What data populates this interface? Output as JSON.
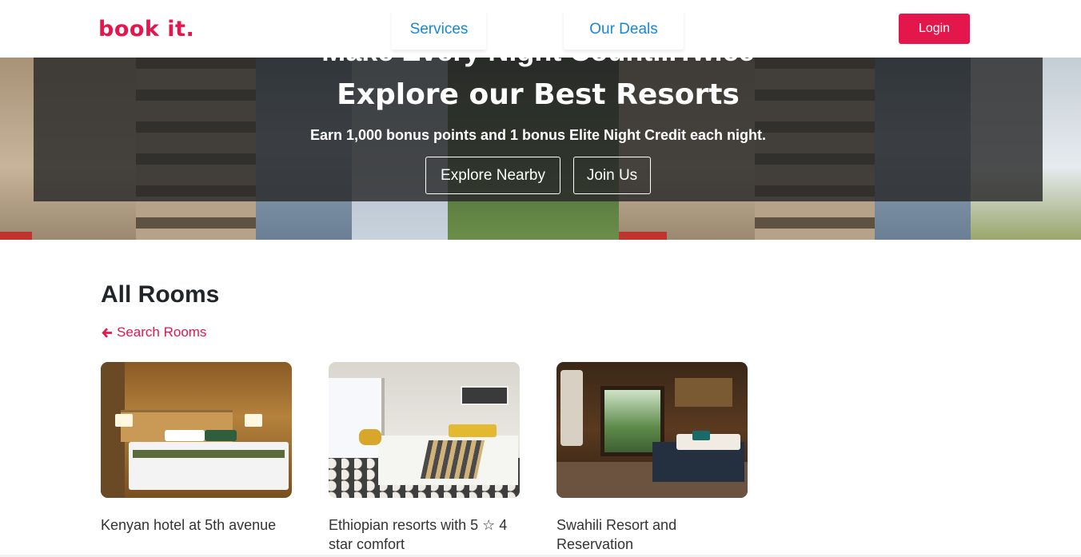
{
  "brand": {
    "logo_text": "book it.",
    "accent_color": "#e4174c",
    "link_color": "#1a86d8"
  },
  "nav": {
    "links": [
      {
        "label": "Services"
      },
      {
        "label": "Our Deals"
      }
    ],
    "login_label": "Login"
  },
  "hero": {
    "clipped_heading": "Make Every Night Count...Twice",
    "title": "Explore our Best Resorts",
    "subtitle": "Earn 1,000 bonus points and 1 bonus Elite Night Credit each night.",
    "buttons": [
      {
        "label": "Explore Nearby"
      },
      {
        "label": "Join Us"
      }
    ]
  },
  "rooms": {
    "heading": "All Rooms",
    "search_link": "Search Rooms",
    "search_icon": "arrow-left-icon",
    "cards": [
      {
        "title": "Kenyan hotel at 5th avenue"
      },
      {
        "title": "Ethiopian resorts with 5 ☆ 4 star comfort"
      },
      {
        "title": "Swahili Resort and Reservation"
      }
    ]
  }
}
